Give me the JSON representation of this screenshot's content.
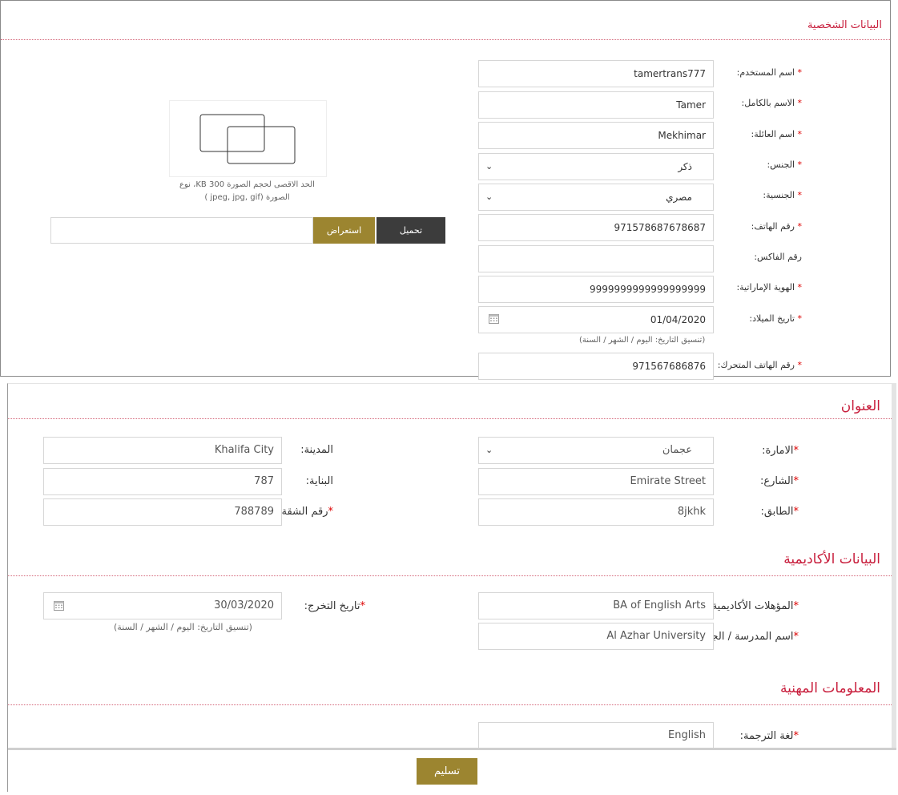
{
  "personal": {
    "title": "البيانات الشخصية",
    "required_mark": "*",
    "username": {
      "label": "اسم المستخدم:",
      "value": "tamertrans777"
    },
    "full_name": {
      "label": "الاسم بالكامل:",
      "value": "Tamer"
    },
    "family_name": {
      "label": "اسم العائلة:",
      "value": "Mekhimar"
    },
    "gender": {
      "label": "الجنس:",
      "value": "ذكر"
    },
    "nationality": {
      "label": "الجنسية:",
      "value": "مصري"
    },
    "phone": {
      "label": "رقم الهاتف:",
      "value": "971578687678687"
    },
    "fax": {
      "label": "رقم الفاكس:",
      "value": ""
    },
    "emirates_id": {
      "label": "الهوية الإماراتية:",
      "value": "9999999999999999999"
    },
    "birth_date": {
      "label": "تاريخ الميلاد:",
      "value": "01/04/2020",
      "hint": "(تنسيق التاريخ: اليوم / الشهر / السنة)"
    },
    "mobile": {
      "label": "رقم الهاتف المتحرك:",
      "value": "971567686876"
    },
    "photo": {
      "hint_line1": "الحد الاقصى لحجم الصورة 300 KB، نوع",
      "hint_line2": "الصورة (jpeg, jpg, gif )"
    },
    "upload_label": "تحميل",
    "browse_label": "استعراض",
    "file_value": ""
  },
  "address": {
    "title": "العنوان",
    "emirate": {
      "label": "الامارة:",
      "value": "عجمان"
    },
    "city": {
      "label": "المدينة:",
      "value": "Khalifa City"
    },
    "street": {
      "label": "الشارع:",
      "value": "Emirate Street"
    },
    "building": {
      "label": "البناية:",
      "value": "787"
    },
    "floor": {
      "label": "الطابق:",
      "value": "8jkhk"
    },
    "apartment": {
      "label": "رقم الشقة:",
      "value": "788789"
    }
  },
  "academic": {
    "title": "البيانات الأكاديمية",
    "qualification": {
      "label": "المؤهلات الأكاديمية:",
      "value": "BA of English Arts"
    },
    "school": {
      "label": "اسم المدرسة / الجامعة:",
      "value": "Al Azhar University"
    },
    "graduation_date": {
      "label": "تاريخ التخرج:",
      "value": "30/03/2020",
      "hint": "(تنسيق التاريخ: اليوم / الشهر / السنة)"
    }
  },
  "professional": {
    "title": "المعلومات المهنية",
    "translation_language": {
      "label": "لغة الترجمة:",
      "value": "English"
    }
  },
  "submit_label": "تسليم",
  "colors": {
    "accent": "#9c8530",
    "dark_button": "#3c3c3c",
    "title_red": "#c81e3c"
  },
  "icons": [
    "chevron-down-icon",
    "calendar-icon",
    "photo-placeholder-icon"
  ]
}
